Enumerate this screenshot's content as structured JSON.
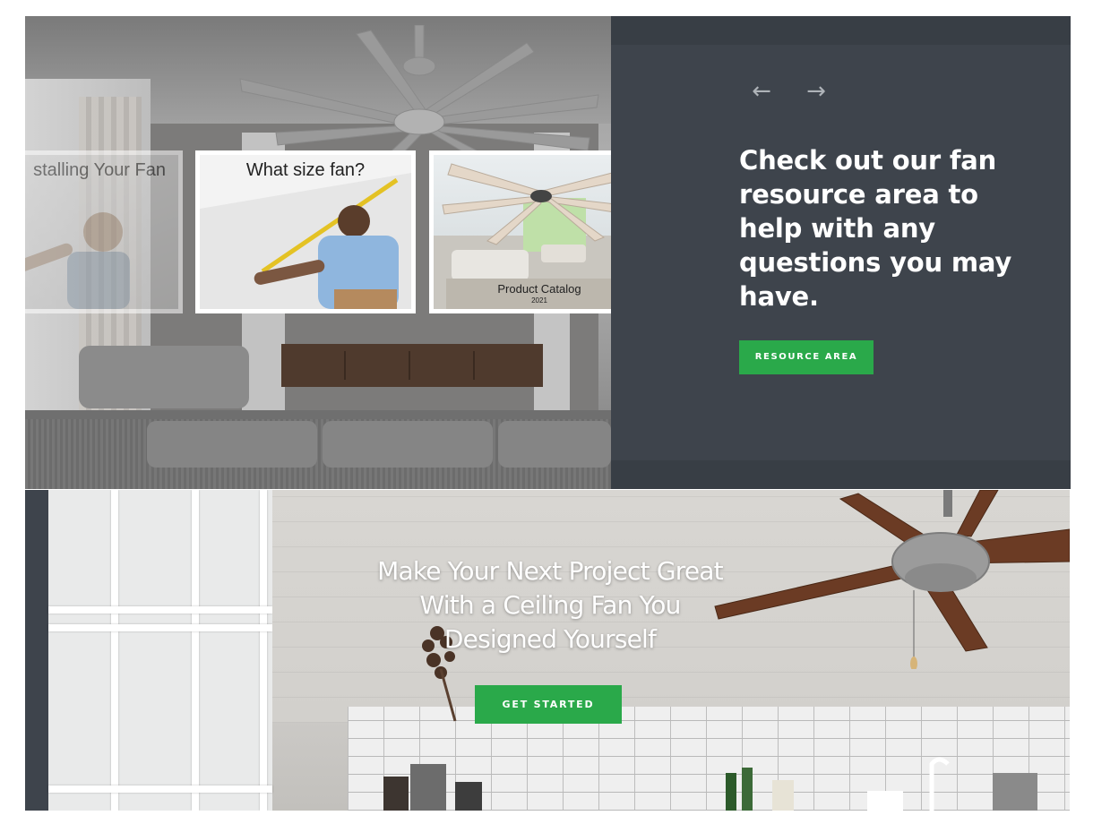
{
  "colors": {
    "accent_green": "#2aa94a",
    "panel_dark": "#3e444c",
    "arrow_gray": "#aeb3b8",
    "white": "#ffffff"
  },
  "resource_section": {
    "nav": {
      "prev_icon": "arrow-left-icon",
      "next_icon": "arrow-right-icon",
      "prev_glyph": "←",
      "next_glyph": "→"
    },
    "cards": [
      {
        "caption": "Installing Your Fan",
        "visible_caption": "stalling Your Fan"
      },
      {
        "caption": "What size fan?"
      },
      {
        "caption": "Product Catalog",
        "subcaption": "2021"
      }
    ],
    "heading": "Check out our fan resource area to help with any questions you may have.",
    "button_label": "Resource Area"
  },
  "designer_section": {
    "heading": "Make Your Next Project Great With a Ceiling Fan You Designed Yourself",
    "button_label": "Get Started"
  }
}
